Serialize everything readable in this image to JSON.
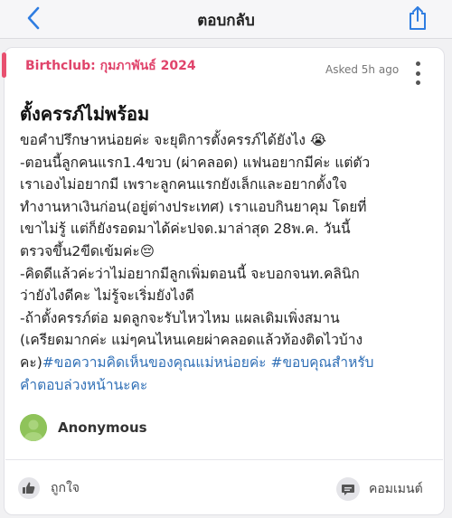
{
  "topbar": {
    "title": "ตอบกลับ",
    "back_icon": "chevron-left-icon",
    "share_icon": "share-icon"
  },
  "post": {
    "club_tag": "Birthclub: กุมภาพันธ์ 2024",
    "asked_time": "Asked 5h ago",
    "title": "ตั้งครรภ์ไม่พร้อม",
    "body_lines": [
      "ขอคำปรึกษาหน่อยค่ะ จะยุติการตั้งครรภ์ได้ยังไง 😭",
      "-ตอนนี้ลูกคนแรก1.4ขวบ (ผ่าคลอด) แฟนอยากมีค่ะ แต่ตัว",
      "เราเองไม่อยากมี เพราะลูกคนแรกยังเล็กและอยากตั้งใจ",
      "ทำงานหาเงินก่อน(อยู่ต่างประเทศ) เราแอบกินยาคุม โดยที่",
      "เขาไม่รู้ แต่ก็ยังรอดมาได้ค่ะปจด.มาล่าสุด 28พ.ค. วันนี้",
      "ตรวจขึ้น2ขีดเข้มค่ะ😔",
      "-คิดดีแล้วค่ะว่าไม่อยากมีลูกเพิ่มตอนนี้ จะบอกจนท.คลินิก",
      "ว่ายังไงดีคะ ไม่รู้จะเริ่มยังไงดี",
      "-ถ้าตั้งครรภ์ต่อ มดลูกจะรับไหวไหม แผลเดิมเพิ่งสมาน",
      "(เครียดมากค่ะ แม่ๆคนไหนเคยผ่าคลอดแล้วท้องติดไวบ้าง"
    ],
    "last_line_prefix": "คะ)",
    "hashtag_1": "#ขอความคิดเห็นของคุณแม่หน่อยค่ะ",
    "hashtag_2_part1": "#ขอบคุณสำหรับ",
    "hashtag_2_part2": "คำตอบล่วงหน้านะคะ",
    "author_name": "Anonymous",
    "more_icon": "more-vertical-icon"
  },
  "actions": {
    "like_label": "ถูกใจ",
    "comment_label": "คอมเมนต์",
    "like_icon": "thumbs-up-icon",
    "comment_icon": "comment-icon"
  },
  "colors": {
    "accent_pink": "#e0446b",
    "link_blue": "#2f6fb6",
    "ios_blue": "#2f7de1",
    "avatar_green": "#8fc35a"
  }
}
